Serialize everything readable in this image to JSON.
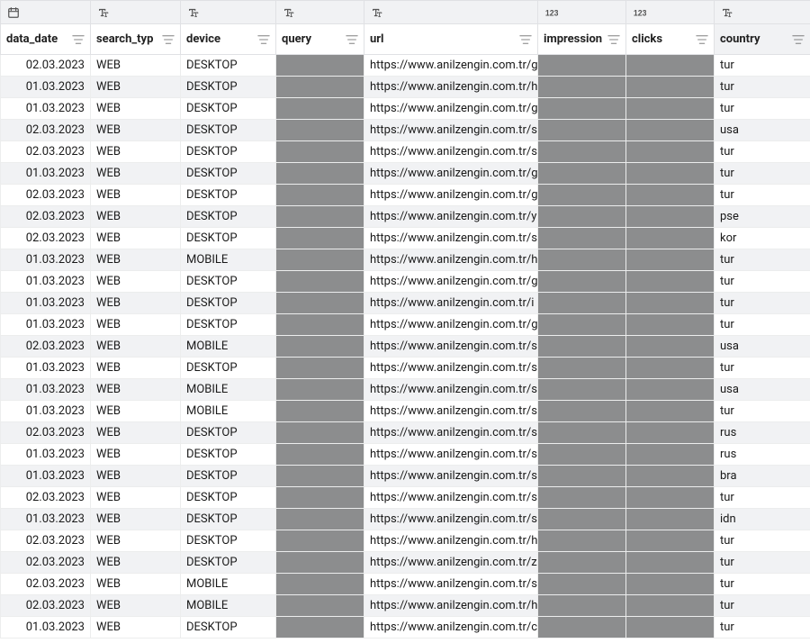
{
  "columns": [
    {
      "key": "data_date",
      "label": "data_date",
      "type": "date",
      "shaded": false
    },
    {
      "key": "search_type",
      "label": "search_typ",
      "type": "text",
      "shaded": false
    },
    {
      "key": "device",
      "label": "device",
      "type": "text",
      "shaded": false
    },
    {
      "key": "query",
      "label": "query",
      "type": "text",
      "shaded": false
    },
    {
      "key": "url",
      "label": "url",
      "type": "text",
      "shaded": false
    },
    {
      "key": "impressions",
      "label": "impression",
      "type": "number",
      "shaded": false
    },
    {
      "key": "clicks",
      "label": "clicks",
      "type": "number",
      "shaded": false
    },
    {
      "key": "country",
      "label": "country",
      "type": "text",
      "shaded": true
    }
  ],
  "type_labels": {
    "date": "",
    "text": "",
    "number": ""
  },
  "redacted_columns": [
    "query",
    "impressions",
    "clicks"
  ],
  "rows": [
    {
      "data_date": "02.03.2023",
      "search_type": "WEB",
      "device": "DESKTOP",
      "query": "",
      "url": "https://www.anilzengin.com.tr/g",
      "impressions": "",
      "clicks": "",
      "country": "tur"
    },
    {
      "data_date": "01.03.2023",
      "search_type": "WEB",
      "device": "DESKTOP",
      "query": "",
      "url": "https://www.anilzengin.com.tr/h",
      "impressions": "",
      "clicks": "",
      "country": "tur"
    },
    {
      "data_date": "01.03.2023",
      "search_type": "WEB",
      "device": "DESKTOP",
      "query": "",
      "url": "https://www.anilzengin.com.tr/g",
      "impressions": "",
      "clicks": "",
      "country": "tur"
    },
    {
      "data_date": "02.03.2023",
      "search_type": "WEB",
      "device": "DESKTOP",
      "query": "",
      "url": "https://www.anilzengin.com.tr/s",
      "impressions": "",
      "clicks": "",
      "country": "usa"
    },
    {
      "data_date": "02.03.2023",
      "search_type": "WEB",
      "device": "DESKTOP",
      "query": "",
      "url": "https://www.anilzengin.com.tr/s",
      "impressions": "",
      "clicks": "",
      "country": "tur"
    },
    {
      "data_date": "01.03.2023",
      "search_type": "WEB",
      "device": "DESKTOP",
      "query": "",
      "url": "https://www.anilzengin.com.tr/g",
      "impressions": "",
      "clicks": "",
      "country": "tur"
    },
    {
      "data_date": "02.03.2023",
      "search_type": "WEB",
      "device": "DESKTOP",
      "query": "",
      "url": "https://www.anilzengin.com.tr/g",
      "impressions": "",
      "clicks": "",
      "country": "tur"
    },
    {
      "data_date": "02.03.2023",
      "search_type": "WEB",
      "device": "DESKTOP",
      "query": "",
      "url": "https://www.anilzengin.com.tr/y",
      "impressions": "",
      "clicks": "",
      "country": "pse"
    },
    {
      "data_date": "02.03.2023",
      "search_type": "WEB",
      "device": "DESKTOP",
      "query": "",
      "url": "https://www.anilzengin.com.tr/s",
      "impressions": "",
      "clicks": "",
      "country": "kor"
    },
    {
      "data_date": "01.03.2023",
      "search_type": "WEB",
      "device": "MOBILE",
      "query": "",
      "url": "https://www.anilzengin.com.tr/h",
      "impressions": "",
      "clicks": "",
      "country": "tur"
    },
    {
      "data_date": "01.03.2023",
      "search_type": "WEB",
      "device": "DESKTOP",
      "query": "",
      "url": "https://www.anilzengin.com.tr/g",
      "impressions": "",
      "clicks": "",
      "country": "tur"
    },
    {
      "data_date": "01.03.2023",
      "search_type": "WEB",
      "device": "DESKTOP",
      "query": "",
      "url": "https://www.anilzengin.com.tr/i",
      "impressions": "",
      "clicks": "",
      "country": "tur"
    },
    {
      "data_date": "01.03.2023",
      "search_type": "WEB",
      "device": "DESKTOP",
      "query": "",
      "url": "https://www.anilzengin.com.tr/g",
      "impressions": "",
      "clicks": "",
      "country": "tur"
    },
    {
      "data_date": "02.03.2023",
      "search_type": "WEB",
      "device": "MOBILE",
      "query": "",
      "url": "https://www.anilzengin.com.tr/s",
      "impressions": "",
      "clicks": "",
      "country": "usa"
    },
    {
      "data_date": "01.03.2023",
      "search_type": "WEB",
      "device": "DESKTOP",
      "query": "",
      "url": "https://www.anilzengin.com.tr/s",
      "impressions": "",
      "clicks": "",
      "country": "tur"
    },
    {
      "data_date": "01.03.2023",
      "search_type": "WEB",
      "device": "MOBILE",
      "query": "",
      "url": "https://www.anilzengin.com.tr/s",
      "impressions": "",
      "clicks": "",
      "country": "usa"
    },
    {
      "data_date": "01.03.2023",
      "search_type": "WEB",
      "device": "MOBILE",
      "query": "",
      "url": "https://www.anilzengin.com.tr/s",
      "impressions": "",
      "clicks": "",
      "country": "tur"
    },
    {
      "data_date": "02.03.2023",
      "search_type": "WEB",
      "device": "DESKTOP",
      "query": "",
      "url": "https://www.anilzengin.com.tr/s",
      "impressions": "",
      "clicks": "",
      "country": "rus"
    },
    {
      "data_date": "01.03.2023",
      "search_type": "WEB",
      "device": "DESKTOP",
      "query": "",
      "url": "https://www.anilzengin.com.tr/s",
      "impressions": "",
      "clicks": "",
      "country": "rus"
    },
    {
      "data_date": "01.03.2023",
      "search_type": "WEB",
      "device": "DESKTOP",
      "query": "",
      "url": "https://www.anilzengin.com.tr/s",
      "impressions": "",
      "clicks": "",
      "country": "bra"
    },
    {
      "data_date": "02.03.2023",
      "search_type": "WEB",
      "device": "DESKTOP",
      "query": "",
      "url": "https://www.anilzengin.com.tr/s",
      "impressions": "",
      "clicks": "",
      "country": "tur"
    },
    {
      "data_date": "01.03.2023",
      "search_type": "WEB",
      "device": "DESKTOP",
      "query": "",
      "url": "https://www.anilzengin.com.tr/s",
      "impressions": "",
      "clicks": "",
      "country": "idn"
    },
    {
      "data_date": "02.03.2023",
      "search_type": "WEB",
      "device": "DESKTOP",
      "query": "",
      "url": "https://www.anilzengin.com.tr/h",
      "impressions": "",
      "clicks": "",
      "country": "tur"
    },
    {
      "data_date": "02.03.2023",
      "search_type": "WEB",
      "device": "DESKTOP",
      "query": "",
      "url": "https://www.anilzengin.com.tr/z",
      "impressions": "",
      "clicks": "",
      "country": "tur"
    },
    {
      "data_date": "02.03.2023",
      "search_type": "WEB",
      "device": "MOBILE",
      "query": "",
      "url": "https://www.anilzengin.com.tr/s",
      "impressions": "",
      "clicks": "",
      "country": "tur"
    },
    {
      "data_date": "02.03.2023",
      "search_type": "WEB",
      "device": "MOBILE",
      "query": "",
      "url": "https://www.anilzengin.com.tr/h",
      "impressions": "",
      "clicks": "",
      "country": "tur"
    },
    {
      "data_date": "01.03.2023",
      "search_type": "WEB",
      "device": "DESKTOP",
      "query": "",
      "url": "https://www.anilzengin.com.tr/c",
      "impressions": "",
      "clicks": "",
      "country": "tur"
    }
  ]
}
